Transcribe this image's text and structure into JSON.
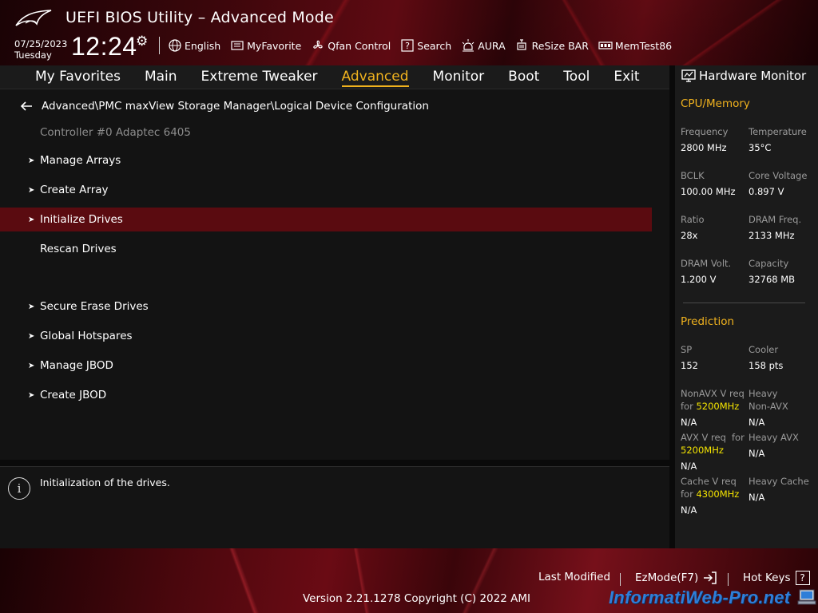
{
  "header": {
    "title": "UEFI BIOS Utility – Advanced Mode",
    "date": "07/25/2023",
    "day": "Tuesday",
    "time": "12:24",
    "tools": [
      {
        "label": "English",
        "icon": "globe-icon"
      },
      {
        "label": "MyFavorite",
        "icon": "favorite-list-icon"
      },
      {
        "label": "Qfan Control",
        "icon": "fan-icon"
      },
      {
        "label": "Search",
        "icon": "question-box-icon"
      },
      {
        "label": "AURA",
        "icon": "aura-light-icon"
      },
      {
        "label": "ReSize BAR",
        "icon": "resize-bar-icon"
      },
      {
        "label": "MemTest86",
        "icon": "memory-icon"
      }
    ]
  },
  "tabs": [
    "My Favorites",
    "Main",
    "Extreme Tweaker",
    "Advanced",
    "Monitor",
    "Boot",
    "Tool",
    "Exit"
  ],
  "active_tab": "Advanced",
  "main": {
    "breadcrumb": "Advanced\\PMC maxView Storage Manager\\Logical Device Configuration",
    "controller": "Controller #0 Adaptec 6405",
    "items": [
      {
        "label": "Manage Arrays",
        "arrow": "➤"
      },
      {
        "label": "Create Array",
        "arrow": "➤"
      },
      {
        "label": "Initialize Drives",
        "arrow": "➤"
      },
      {
        "label": "Rescan Drives",
        "arrow": ""
      },
      {
        "label": "Secure Erase Drives",
        "arrow": "➤"
      },
      {
        "label": "Global Hotspares",
        "arrow": "➤"
      },
      {
        "label": "Manage JBOD",
        "arrow": "➤"
      },
      {
        "label": "Create JBOD",
        "arrow": "➤"
      }
    ],
    "selected_item": "Initialize Drives"
  },
  "help": {
    "text": "Initialization of the drives."
  },
  "hardware_monitor": {
    "title": "Hardware Monitor",
    "cpu_memory": {
      "title": "CPU/Memory",
      "frequency_label": "Frequency",
      "frequency": "2800 MHz",
      "temperature_label": "Temperature",
      "temperature": "35°C",
      "bclk_label": "BCLK",
      "bclk": "100.00 MHz",
      "core_voltage_label": "Core Voltage",
      "core_voltage": "0.897 V",
      "ratio_label": "Ratio",
      "ratio": "28x",
      "dram_freq_label": "DRAM Freq.",
      "dram_freq": "2133 MHz",
      "dram_volt_label": "DRAM Volt.",
      "dram_volt": "1.200 V",
      "capacity_label": "Capacity",
      "capacity": "32768 MB"
    },
    "prediction": {
      "title": "Prediction",
      "sp_label": "SP",
      "sp": "152",
      "cooler_label": "Cooler",
      "cooler": "158 pts",
      "nonavx_label_1": "NonAVX V req",
      "nonavx_label_2": "for",
      "nonavx_freq": "5200MHz",
      "nonavx": "N/A",
      "heavy_nonavx_label_1": "Heavy",
      "heavy_nonavx_label_2": "Non-AVX",
      "heavy_nonavx": "N/A",
      "avx_label_1": "AVX V req",
      "avx_label_2": "for",
      "avx_freq": "5200MHz",
      "avx": "N/A",
      "heavy_avx_label": "Heavy AVX",
      "heavy_avx": "N/A",
      "cache_label_1": "Cache V req",
      "cache_label_2": "for",
      "cache_freq": "4300MHz",
      "cache": "N/A",
      "heavy_cache_label": "Heavy Cache",
      "heavy_cache": "N/A"
    }
  },
  "footer": {
    "last_modified": "Last Modified",
    "ezmode": "EzMode(F7)",
    "hotkeys": "Hot Keys",
    "hotkeys_key": "?",
    "version": "Version 2.21.1278 Copyright (C) 2022 AMI",
    "watermark": "InformatiWeb-Pro.net"
  },
  "colors": {
    "accent": "#f0b21e",
    "selection": "#5a0b10",
    "highlight_value": "#f4e400",
    "watermark": "#2f7ed8"
  }
}
